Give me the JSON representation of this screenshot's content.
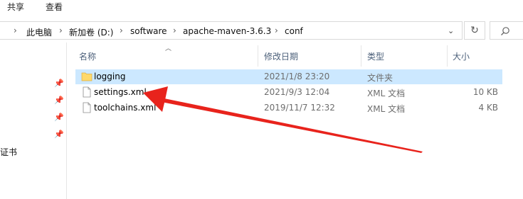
{
  "ribbon": {
    "tabs": [
      "共享",
      "查看"
    ]
  },
  "address": {
    "crumbs": [
      "此电脑",
      "新加卷 (D:)",
      "software",
      "apache-maven-3.6.3",
      "conf"
    ],
    "separator": "›",
    "dropdown": "⌄",
    "refresh_icon": "refresh-icon",
    "search_icon": "search-icon"
  },
  "columns": {
    "name": "名称",
    "modified": "修改日期",
    "type": "类型",
    "size": "大小"
  },
  "files": [
    {
      "name": "logging",
      "modified": "2021/1/8 23:20",
      "type": "文件夹",
      "size": "",
      "icon": "folder-icon",
      "selected": true
    },
    {
      "name": "settings.xml",
      "modified": "2021/9/3 12:04",
      "type": "XML 文档",
      "size": "10 KB",
      "icon": "document-icon",
      "selected": false
    },
    {
      "name": "toolchains.xml",
      "modified": "2019/11/7 12:32",
      "type": "XML 文档",
      "size": "4 KB",
      "icon": "document-icon",
      "selected": false
    }
  ],
  "nav": {
    "partial_label": "证书"
  },
  "annotation": {
    "color": "#e8231c",
    "icon": "red-arrow"
  },
  "colors": {
    "selection": "#cce8ff",
    "folder": "#ffd96b",
    "header_text": "#4c607a"
  }
}
